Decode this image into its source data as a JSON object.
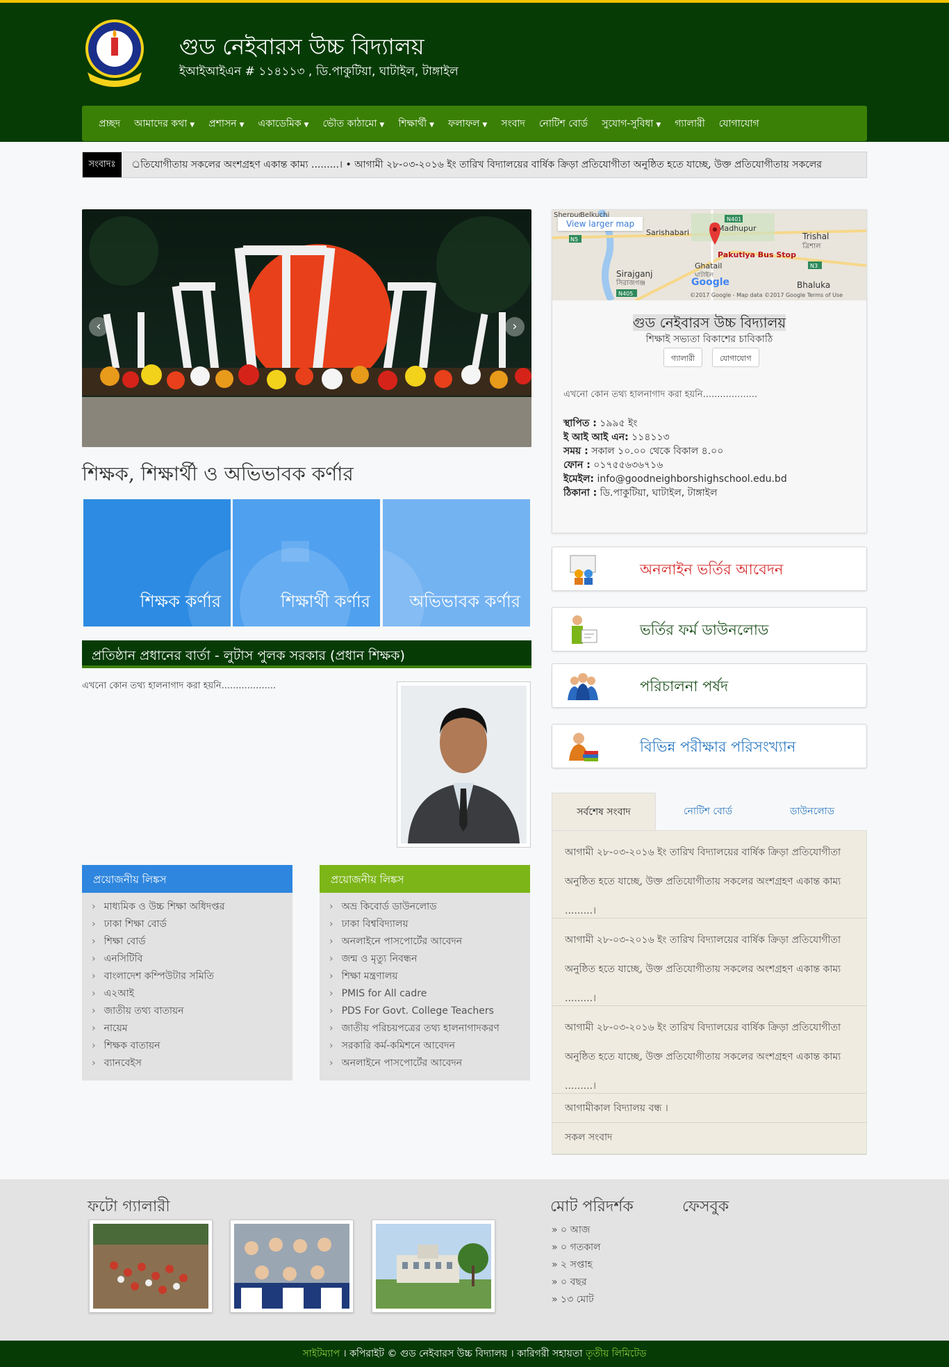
{
  "site": {
    "title": "গুড নেইবারস উচ্চ বিদ্যালয়",
    "subtitle": "ইআইআইএন # ১১৪১১৩ , ডি.পাকুটিয়া, ঘাটাইল, টাঙ্গাইল"
  },
  "nav": [
    {
      "label": "প্রচ্ছদ",
      "dropdown": false
    },
    {
      "label": "আমাদের কথা",
      "dropdown": true
    },
    {
      "label": "প্রশাসন",
      "dropdown": true
    },
    {
      "label": "একাডেমিক",
      "dropdown": true
    },
    {
      "label": "ভৌত কাঠামো",
      "dropdown": true
    },
    {
      "label": "শিক্ষার্থী",
      "dropdown": true
    },
    {
      "label": "ফলাফল",
      "dropdown": true
    },
    {
      "label": "সংবাদ",
      "dropdown": false
    },
    {
      "label": "নোটিশ বোর্ড",
      "dropdown": false
    },
    {
      "label": "সুযোগ-সুবিধা",
      "dropdown": true
    },
    {
      "label": "গ্যালারী",
      "dropdown": false
    },
    {
      "label": "যোগাযোগ",
      "dropdown": false
    }
  ],
  "ticker": {
    "label": "সংবাদঃ",
    "text": "্রতিযোগীতায় সকলের অংশগ্রহণ একান্ত কাম্য .........।  •  আগামী ২৮-০৩-২০১৬ ইং তারিখ বিদ্যালয়ের বার্ষিক ক্রিড়া প্রতিযোগীতা অনুষ্ঠিত হতে যাচ্ছে, উক্ত প্রতিযোগীতায় সকলের"
  },
  "slider": {
    "prev": "‹",
    "next": "›"
  },
  "corner": {
    "title": "শিক্ষক, শিক্ষার্থী ও অভিভাবক কর্ণার",
    "boxes": [
      "শিক্ষক কর্ণার",
      "শিক্ষার্থী কর্ণার",
      "অভিভাবক কর্ণার"
    ]
  },
  "head_message": {
    "title": "প্রতিষ্ঠান প্রধানের বার্তা - লুটাস পুলক সরকার (প্রধান শিক্ষক)",
    "text": "এখনো কোন তথ্য হালনাগাদ করা হয়নি..................."
  },
  "links_left": {
    "title": "প্রয়োজনীয় লিঙ্কস",
    "color": "#2e86de",
    "items": [
      "মাধ্যমিক ও উচ্চ শিক্ষা অধিদপ্তর",
      "ঢাকা শিক্ষা বোর্ড",
      "শিক্ষা বোর্ড",
      "এনসিটিবি",
      "বাংলাদেশ কম্পিউটার সমিতি",
      "এ২আই",
      "জাতীয় তথ্য বাতায়ন",
      "নায়েম",
      "শিক্ষক বাতায়ন",
      "ব্যানবেইস"
    ]
  },
  "links_right": {
    "title": "প্রয়োজনীয় লিঙ্কস",
    "color": "#7cb518",
    "items": [
      "অভ্র কিবোর্ড ডাউনলোড",
      "ঢাকা বিশ্ববিদ্যালয়",
      "অনলাইনে পাসপোর্টের আবেদন",
      "জন্ম ও মৃত্যু নিবন্ধন",
      "শিক্ষা মন্ত্রণালয়",
      "PMIS for All cadre",
      "PDS For Govt. College Teachers",
      "জাতীয় পরিচয়পত্রের তথ্য হালনাগাদকরণ",
      "সরকারি কর্ম-কমিশনে আবেদন",
      "অনলাইনে পাসপোর্টের আবেদন"
    ]
  },
  "map": {
    "link": "View larger map",
    "places": [
      "Sherpur",
      "Belkuchi",
      "Sarishabari",
      "Madhupur",
      "Trishal",
      "ত্রিশাল",
      "Pakutiya Bus Stop",
      "Ghatail",
      "ঘাটাইল",
      "Sirajganj",
      "সিরাজগঞ্জ",
      "Bhaluka",
      "Google"
    ],
    "roads": [
      "N401",
      "N5",
      "N3",
      "N405"
    ],
    "credit": "©2017 Google - Map data ©2017 Google   Terms of Use"
  },
  "card": {
    "title": "গুড নেইবারস উচ্চ বিদ্যালয়",
    "motto": "শিক্ষাই সভ্যতা বিকাশের চাবিকাঠি",
    "btn_gallery": "গ্যালারী",
    "btn_contact": "যোগাযোগ",
    "note": "এখনো কোন তথ্য হালনাগাদ করা হয়নি...................",
    "rows": [
      {
        "k": "স্থাপিত :",
        "v": " ১৯৯৫ ইং"
      },
      {
        "k": "ই আই আই এন:",
        "v": " ১১৪১১৩"
      },
      {
        "k": "সময় :",
        "v": " সকাল ১০.০০ থেকে বিকাল ৪.০০"
      },
      {
        "k": "ফোন :",
        "v": " ০১৭৫৫৬৩৬৭১৬"
      },
      {
        "k": "ইমেইল:",
        "v": " info@goodneighborshighschool.edu.bd"
      },
      {
        "k": "ঠিকানা :",
        "v": " ডি.পাকুটিয়া, ঘাটাইল, টাঙ্গাইল"
      }
    ]
  },
  "actions": [
    {
      "label": "অনলাইন ভর্তির আবেদন",
      "color": "#d62b2b",
      "icon": "presentation-icon"
    },
    {
      "label": "ভর্তির ফর্ম ডাউনলোড",
      "color": "#1b4f1b",
      "icon": "form-writing-icon"
    },
    {
      "label": "পরিচালনা পর্ষদ",
      "color": "#1b4f1b",
      "icon": "committee-icon"
    },
    {
      "label": "বিভিন্ন পরীক্ষার পরিসংখ্যান",
      "color": "#2a78c0",
      "icon": "exam-stats-icon"
    }
  ],
  "tabs": [
    "সর্বশেষ সংবাদ",
    "নোটিশ বোর্ড",
    "ডাউনলোড"
  ],
  "news": [
    "আগামী ২৮-০৩-২০১৬ ইং তারিখ বিদ্যালয়ের বার্ষিক ক্রিড়া প্রতিযোগীতা অনুষ্ঠিত হতে যাচ্ছে, উক্ত প্রতিযোগীতায় সকলের অংশগ্রহণ একান্ত কাম্য .........।",
    "আগামী ২৮-০৩-২০১৬ ইং তারিখ বিদ্যালয়ের বার্ষিক ক্রিড়া প্রতিযোগীতা অনুষ্ঠিত হতে যাচ্ছে, উক্ত প্রতিযোগীতায় সকলের অংশগ্রহণ একান্ত কাম্য .........।",
    "আগামী ২৮-০৩-২০১৬ ইং তারিখ বিদ্যালয়ের বার্ষিক ক্রিড়া প্রতিযোগীতা অনুষ্ঠিত হতে যাচ্ছে, উক্ত প্রতিযোগীতায় সকলের অংশগ্রহণ একান্ত কাম্য .........।",
    "আগামীকাল বিদ্যালয় বন্ধ ।",
    "সকল সংবাদ"
  ],
  "footer": {
    "gallery_title": "ফটো গ্যালারী",
    "visitors_title": "মোট পরিদর্শক",
    "facebook_title": "ফেসবুক",
    "visitors": [
      "» ০ আজ",
      "» ০ গতকাল",
      "» ২ সপ্তাহ",
      "» ০ বছর",
      "» ১৩ মোট"
    ]
  },
  "bottom": {
    "sitemap": "সাইটম্যাপ",
    "copyright": " । কপিরাইট © গুড নেইবারস উচ্চ বিদ্যালয় । কারিগরী সহায়তা ",
    "company": "তৃতীয় লিমিটেড"
  },
  "colors": {
    "header": "#063b06",
    "nav": "#3b8006",
    "topbar": "#f2c200"
  }
}
